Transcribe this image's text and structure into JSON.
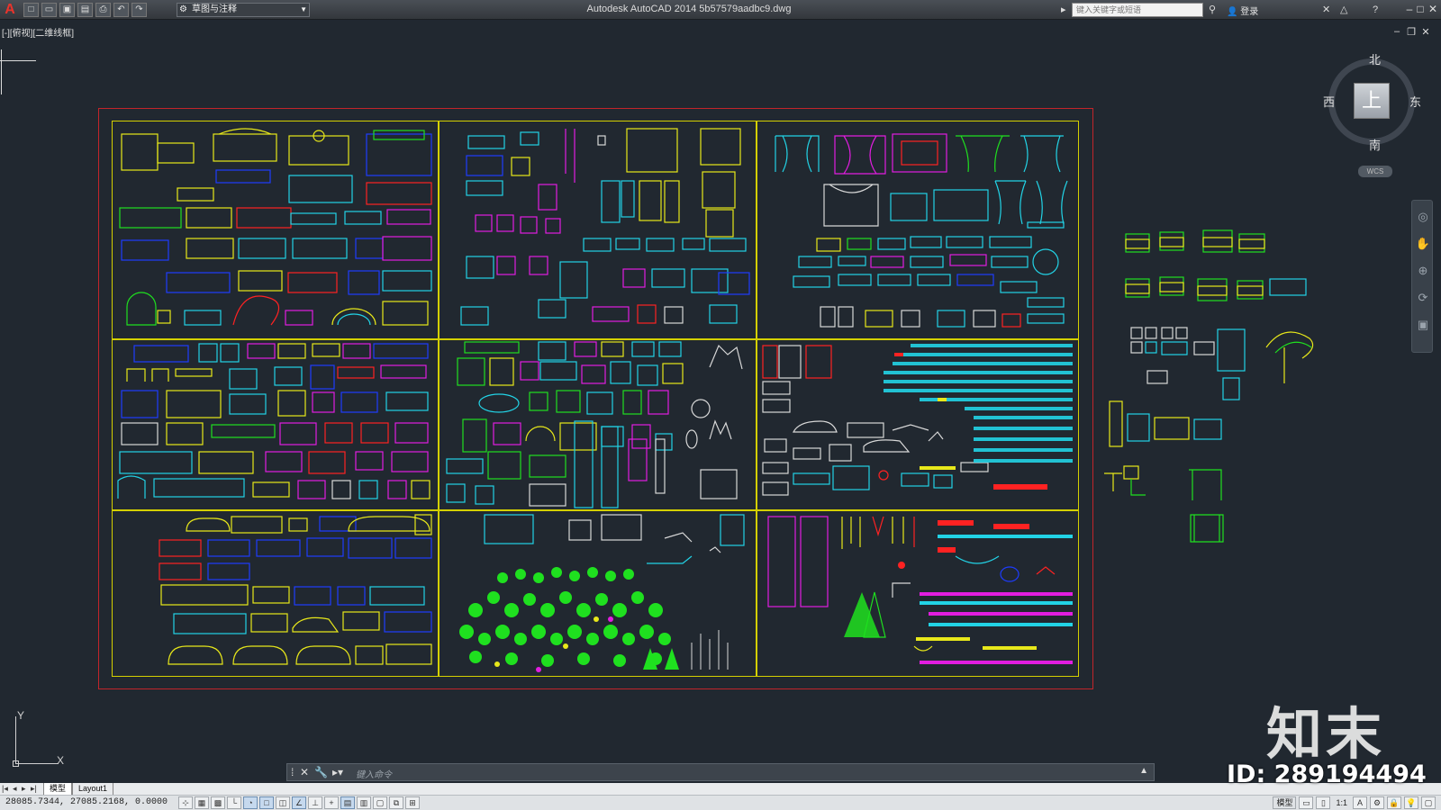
{
  "window": {
    "app_title": "Autodesk AutoCAD 2014    5b57579aadbc9.dwg",
    "workspace": "草图与注释",
    "search_placeholder": "键入关键字或短语",
    "login_label": "登录"
  },
  "quick_access": [
    "new-icon",
    "open-icon",
    "save-icon",
    "saveas-icon",
    "plot-icon",
    "undo-icon",
    "redo-icon"
  ],
  "viewport": {
    "label": "[-][俯视][二维线框]"
  },
  "viewcube": {
    "north": "北",
    "south": "南",
    "east": "东",
    "west": "西",
    "face": "上",
    "wcs": "WCS"
  },
  "ucs": {
    "x": "X",
    "y": "Y"
  },
  "command": {
    "placeholder": "键入命令"
  },
  "layout_tabs": {
    "model": "模型",
    "layout1": "Layout1"
  },
  "status": {
    "coordinates": "28085.7344, 27085.2168, 0.0000",
    "model_label": "模型",
    "annotation_scale": "1:1"
  },
  "watermark": {
    "brand": "知末",
    "id": "ID: 289194494"
  },
  "colors": {
    "background": "#212830",
    "sheet_border": "#c2252a",
    "panel_frame": "#d4d000",
    "cyan": "#22d3e6",
    "yellow": "#e8e81a",
    "magenta": "#e21de0",
    "blue": "#1e3cff",
    "green": "#1fe01f",
    "red": "#ff2222",
    "white": "#d8d8d8"
  }
}
